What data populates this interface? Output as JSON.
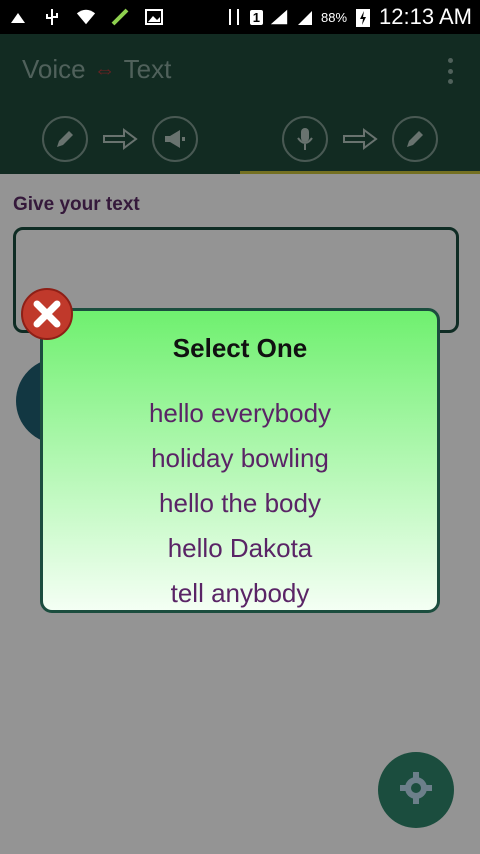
{
  "status_bar": {
    "battery_pct": "88%",
    "sim": "1",
    "time": "12:13 AM"
  },
  "app": {
    "title_left": "Voice",
    "title_arrow": "⇔",
    "title_right": "Text"
  },
  "tabs": [
    {
      "name": "text-to-voice",
      "icons": [
        "pencil-icon",
        "arrow-right-icon",
        "megaphone-icon"
      ],
      "active": false
    },
    {
      "name": "voice-to-text",
      "icons": [
        "microphone-icon",
        "arrow-right-icon",
        "pencil-icon"
      ],
      "active": true
    }
  ],
  "content": {
    "label": "Give your text"
  },
  "dialog": {
    "title": "Select One",
    "options": [
      "hello everybody",
      "holiday bowling",
      "hello the body",
      "hello Dakota",
      "tell anybody"
    ]
  },
  "colors": {
    "app_bar": "#1f4a3c",
    "tab_indicator": "#c8c23a",
    "label": "#5c2b66",
    "dialog_top": "#6ff06f",
    "dialog_bottom": "#f4fff4"
  }
}
